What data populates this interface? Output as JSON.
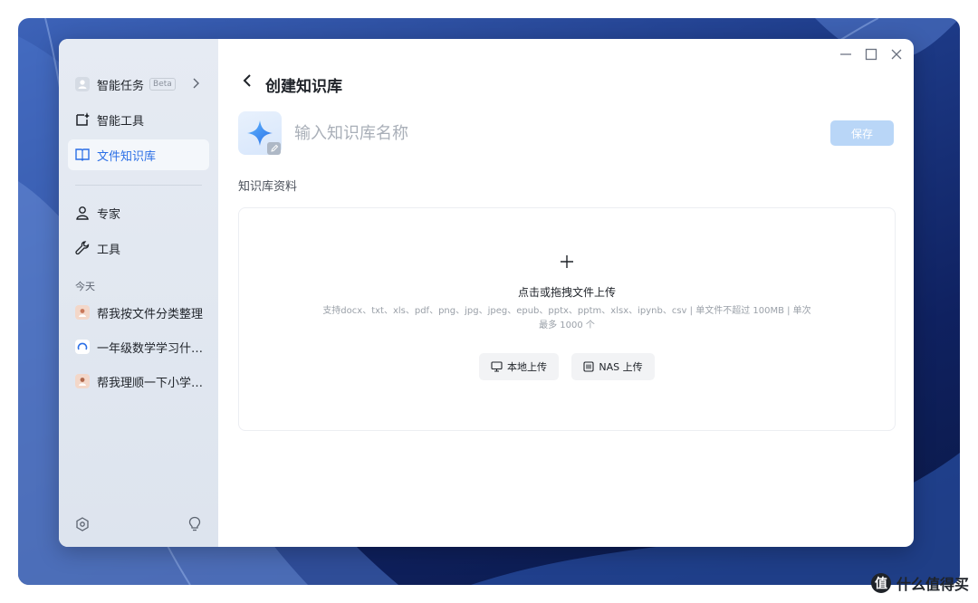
{
  "sidebar": {
    "items_top": [
      {
        "label": "智能任务",
        "badge": "Beta",
        "icon": "person-avatar-icon"
      },
      {
        "label": "智能工具",
        "icon": "chat-sparkle-icon"
      },
      {
        "label": "文件知识库",
        "icon": "book-icon"
      }
    ],
    "items_mid": [
      {
        "label": "专家",
        "icon": "user-icon"
      },
      {
        "label": "工具",
        "icon": "wrench-icon"
      }
    ],
    "history_header": "今天",
    "history": [
      {
        "label": "帮我按文件分类整理",
        "icon": "user-avatar-icon"
      },
      {
        "label": "一年级数学学习什…",
        "icon": "loading-ring-icon"
      },
      {
        "label": "帮我理顺一下小学…",
        "icon": "user-avatar-icon"
      }
    ]
  },
  "main": {
    "title": "创建知识库",
    "name_placeholder": "输入知识库名称",
    "save_label": "保存",
    "section_label": "知识库资料",
    "upload": {
      "title": "点击或拖拽文件上传",
      "hint": "支持docx、txt、xls、pdf、png、jpg、jpeg、epub、pptx、pptm、xlsx、ipynb、csv | 单文件不超过 100MB | 单次最多 1000 个",
      "local_label": "本地上传",
      "nas_label": "NAS 上传"
    }
  },
  "watermark": {
    "text": "什么值得买",
    "glyph": "值"
  },
  "colors": {
    "accent": "#2b6fe6",
    "save_disabled": "#b9d6f7",
    "sidebar_bg": "#e2e8f1"
  }
}
